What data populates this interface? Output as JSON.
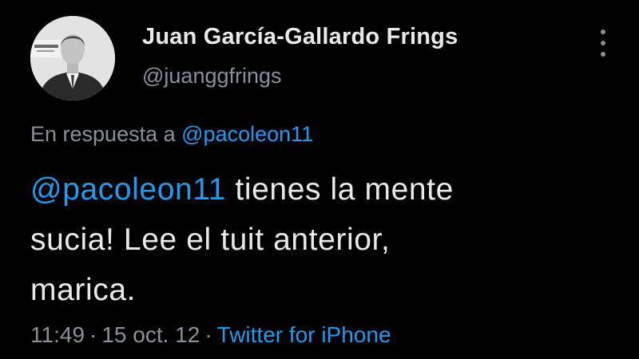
{
  "author": {
    "display_name": "Juan García-Gallardo Frings",
    "handle": "@juanggfrings"
  },
  "reply": {
    "prefix": "En respuesta a",
    "mention": "@pacoleon11"
  },
  "tweet": {
    "mention": "@pacoleon11",
    "line1_rest": " tienes la mente",
    "line2": "sucia! Lee el tuit anterior,",
    "line3": "marica."
  },
  "meta": {
    "time": "11:49",
    "separator": "·",
    "date": "15 oct. 12",
    "source": "Twitter for iPhone"
  },
  "icons": {
    "more": "more-vertical-icon"
  },
  "colors": {
    "background": "#000000",
    "text": "#e7e9ea",
    "secondary": "#8b9096",
    "link": "#1d9bf0"
  }
}
